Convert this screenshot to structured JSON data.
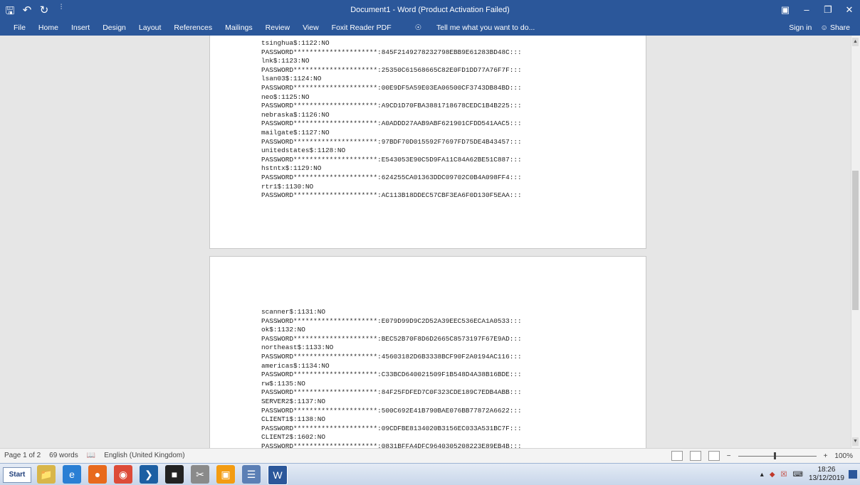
{
  "window": {
    "title": "Document1 - Word (Product Activation Failed)",
    "quick_access": [
      "save-icon",
      "undo-icon",
      "redo-icon",
      "customize-icon"
    ],
    "controls": [
      "ribbon-display-icon",
      "minimize-icon",
      "restore-icon",
      "close-icon"
    ]
  },
  "ribbon": {
    "tabs": [
      "File",
      "Home",
      "Insert",
      "Design",
      "Layout",
      "References",
      "Mailings",
      "Review",
      "View",
      "Foxit Reader PDF"
    ],
    "tell_me": "Tell me what you want to do...",
    "sign_in": "Sign in",
    "share": "Share"
  },
  "document": {
    "page1_lines": [
      "tsinghua$:1122:NO",
      "PASSWORD*********************:845F2149278232798EBB9E61283BD48C:::",
      "lnk$:1123:NO",
      "PASSWORD*********************:25350C61568665C82E0FD1DD77A76F7F:::",
      "lsan03$:1124:NO",
      "PASSWORD*********************:00E9DF5A59E03EA06500CF3743DB84BD:::",
      "neo$:1125:NO",
      "PASSWORD*********************:A9CD1D70FBA3881718678CEDC1B4B225:::",
      "nebraska$:1126:NO",
      "PASSWORD*********************:A0ADDD27AAB9ABF621901CFDD541AAC5:::",
      "mailgate$:1127:NO",
      "PASSWORD*********************:97BDF70D015592F7697FD75DE4B43457:::",
      "unitedstates$:1128:NO",
      "PASSWORD*********************:E543053E90C5D9FA11C84A62BE51C887:::",
      "hstntx$:1129:NO",
      "PASSWORD*********************:624255CA01363DDC09702C0B4A098FF4:::",
      "rtr1$:1130:NO",
      "PASSWORD*********************:AC113B18DDEC57CBF3EA6F0D130F5EAA:::"
    ],
    "page2_lines": [
      "scanner$:1131:NO",
      "PASSWORD*********************:E079D99D9C2D52A39EEC536ECA1A0533:::",
      "ok$:1132:NO",
      "PASSWORD*********************:BEC52B70F8D6D2665C8573197F67E9AD:::",
      "northeast$:1133:NO",
      "PASSWORD*********************:45603182D6B3338BCF90F2A0194AC116:::",
      "americas$:1134:NO",
      "PASSWORD*********************:C33BCD640021509F1B548D4A38B16BDE:::",
      "rw$:1135:NO",
      "PASSWORD*********************:84F25FDFED7C0F323CDE189C7EDB4ABB:::",
      "SERVER2$:1137:NO",
      "PASSWORD*********************:500C692E41B790BAE076BB77872A6622:::",
      "CLIENT1$:1138:NO",
      "PASSWORD*********************:09CDFBE8134020B3156EC033A531BC7F:::",
      "CLIENT2$:1602:NO",
      "PASSWORD*********************:0831BFFA4DFC9640305208223E89EB4B:::"
    ]
  },
  "status": {
    "page": "Page 1 of 2",
    "words": "69 words",
    "language": "English (United Kingdom)",
    "zoom": "100%"
  },
  "taskbar": {
    "start": "Start",
    "clock_time": "18:26",
    "clock_date": "13/12/2019"
  },
  "colors": {
    "ribbon": "#2b579a",
    "page": "#ffffff",
    "canvas": "#e6e6e6"
  }
}
